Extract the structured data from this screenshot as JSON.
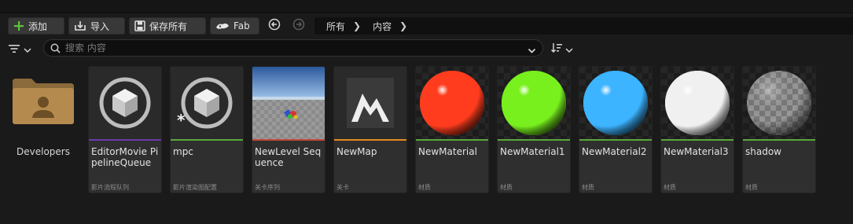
{
  "toolbar": {
    "add_label": "添加",
    "import_label": "导入",
    "save_all_label": "保存所有",
    "fab_label": "Fab"
  },
  "breadcrumb": [
    "所有",
    "内容"
  ],
  "search": {
    "placeholder": "搜索 内容"
  },
  "folder": {
    "name": "Developers"
  },
  "assets": [
    {
      "name": "EditorMovie PipelineQueue",
      "type": "影片流程队列",
      "bar": "#6a3aa8",
      "thumb": "plugin"
    },
    {
      "name": "mpc",
      "type": "影片渲染图配置",
      "bar": "#5aa63c",
      "thumb": "plugin",
      "modified": true
    },
    {
      "name": "NewLevel Sequence",
      "type": "关卡序列",
      "bar": "#c24a3a",
      "thumb": "level"
    },
    {
      "name": "NewMap",
      "type": "关卡",
      "bar": "#e48a1e",
      "thumb": "map"
    },
    {
      "name": "NewMaterial",
      "type": "材质",
      "bar": "#5aa63c",
      "thumb": "sphere",
      "color": "#ff3c1e"
    },
    {
      "name": "NewMaterial1",
      "type": "材质",
      "bar": "#5aa63c",
      "thumb": "sphere",
      "color": "#78f01e"
    },
    {
      "name": "NewMaterial2",
      "type": "材质",
      "bar": "#5aa63c",
      "thumb": "sphere",
      "color": "#3cb4ff"
    },
    {
      "name": "NewMaterial3",
      "type": "材质",
      "bar": "#5aa63c",
      "thumb": "sphere",
      "color": "#f0f0f0"
    },
    {
      "name": "shadow",
      "type": "材质",
      "bar": "#5aa63c",
      "thumb": "checker"
    }
  ],
  "colors": {
    "accent_green": "#5ec33c",
    "panel": "#383838",
    "background": "#1a1a1a"
  }
}
